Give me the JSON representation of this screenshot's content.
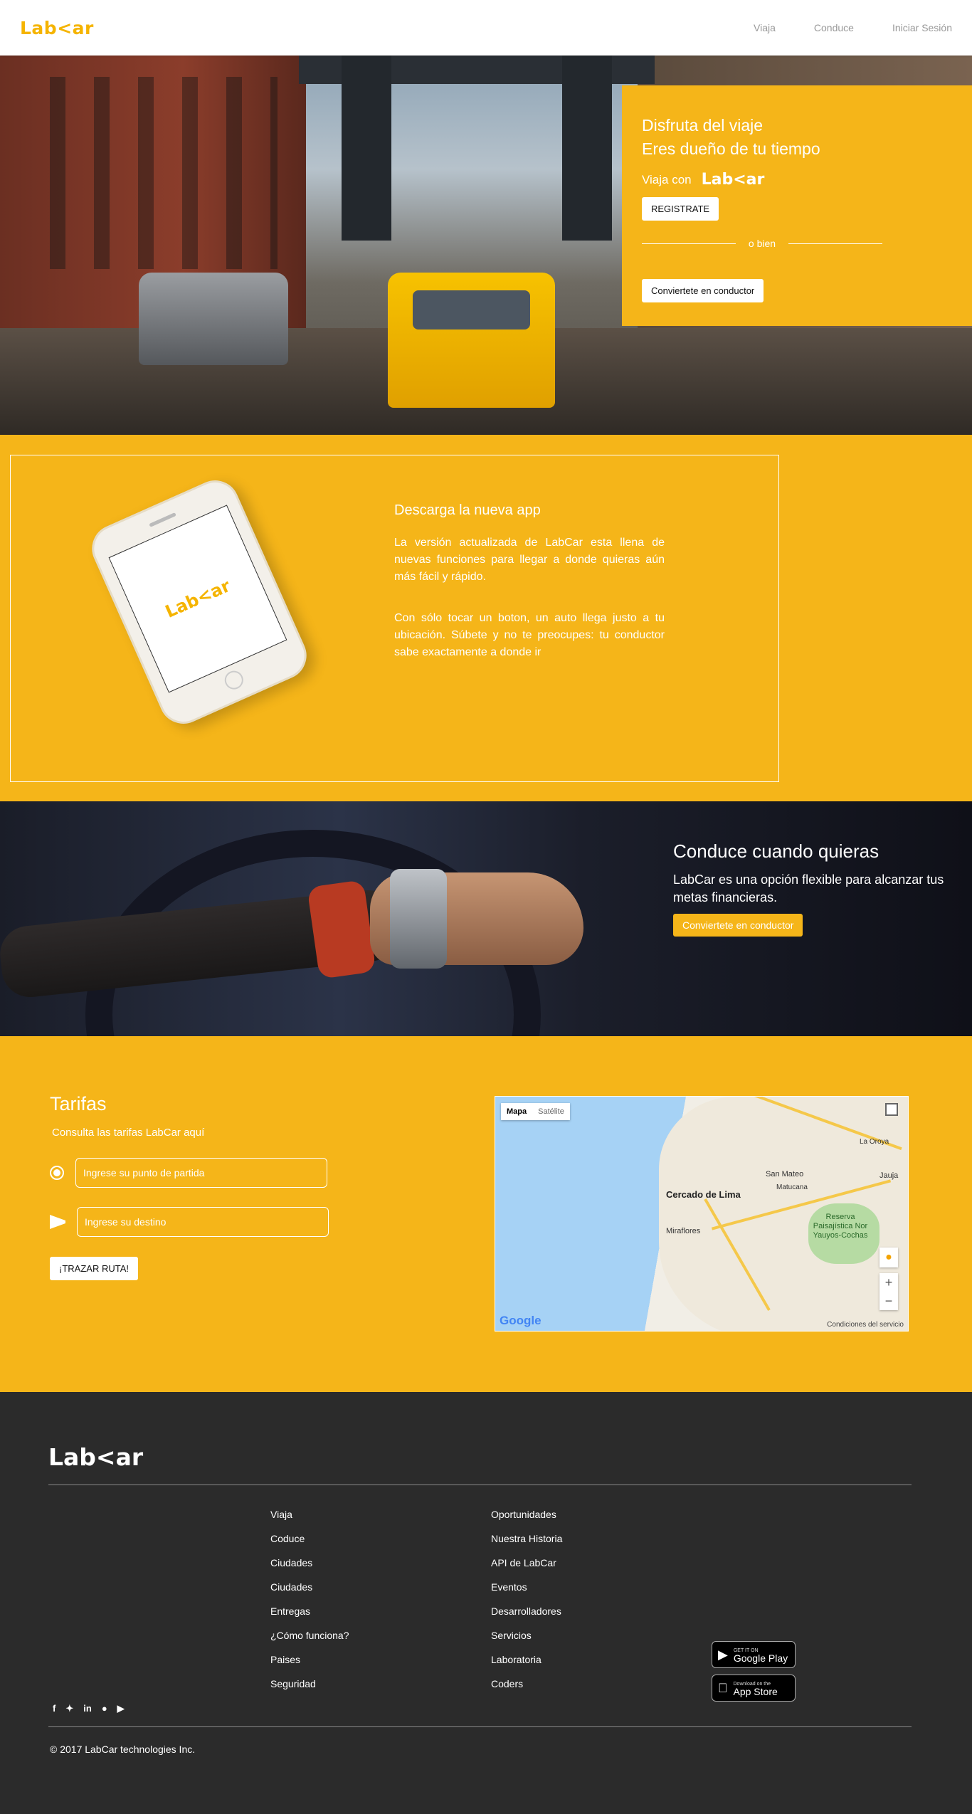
{
  "brand": {
    "logo": "Lab<ar",
    "accent": "#f5b519"
  },
  "nav": {
    "links": [
      "Viaja",
      "Conduce",
      "Iniciar Sesión"
    ]
  },
  "hero": {
    "title_line1": "Disfruta del viaje",
    "title_line2": "Eres dueño de tu tiempo",
    "viaja_con": "Viaja con",
    "brand": "Lab<ar",
    "register_button": "REGISTRATE",
    "divider_text": "o bien",
    "driver_button": "Conviertete en conductor"
  },
  "app": {
    "phone_logo": "Lab<ar",
    "title": "Descarga la nueva app",
    "p1": "La versión actualizada de LabCar esta llena de nuevas funciones para llegar a donde quieras aún más fácil y rápido.",
    "p2": "Con sólo tocar un boton, un auto llega justo a tu ubicación. Súbete y no te preocupes: tu conductor sabe exactamente a donde ir"
  },
  "drive": {
    "title": "Conduce cuando quieras",
    "text": "LabCar es una opción flexible para alcanzar tus metas financieras.",
    "button": "Conviertete en conductor"
  },
  "tarifas": {
    "title": "Tarifas",
    "subtitle": "Consulta las tarifas LabCar aquí",
    "origin_placeholder": "Ingrese su punto de partida",
    "destination_placeholder": "Ingrese su destino",
    "route_button": "¡TRAZAR RUTA!",
    "map": {
      "tab_map": "Mapa",
      "tab_satellite": "Satélite",
      "city_main": "Cercado de Lima",
      "city_miraflores": "Miraflores",
      "city_sanmateo": "San Mateo",
      "city_laoroya": "La Oroya",
      "city_matucana": "Matucana",
      "city_jauja": "Jauja",
      "reserve": "Reserva Paisajística Nor Yauyos-Cochas",
      "zoom_in": "+",
      "zoom_out": "−",
      "google": "Google",
      "terms": "Condiciones del servicio"
    }
  },
  "footer": {
    "logo": "Lab<ar",
    "col1": [
      "Viaja",
      "Coduce",
      "Ciudades",
      "Ciudades",
      "Entregas",
      "¿Cómo funciona?",
      "Paises",
      "Seguridad"
    ],
    "col2": [
      "Oportunidades",
      "Nuestra Historia",
      "API de LabCar",
      "Eventos",
      "Desarrolladores",
      "Servicios",
      "Laboratoria",
      "Coders"
    ],
    "google_play_small": "GET IT ON",
    "google_play": "Google Play",
    "app_store_small": "Download on the",
    "app_store": "App Store",
    "social_icons": [
      "facebook-icon",
      "twitter-icon",
      "linkedin-icon",
      "apple-icon",
      "play-icon"
    ],
    "copyright": "© 2017 LabCar technologies Inc."
  }
}
